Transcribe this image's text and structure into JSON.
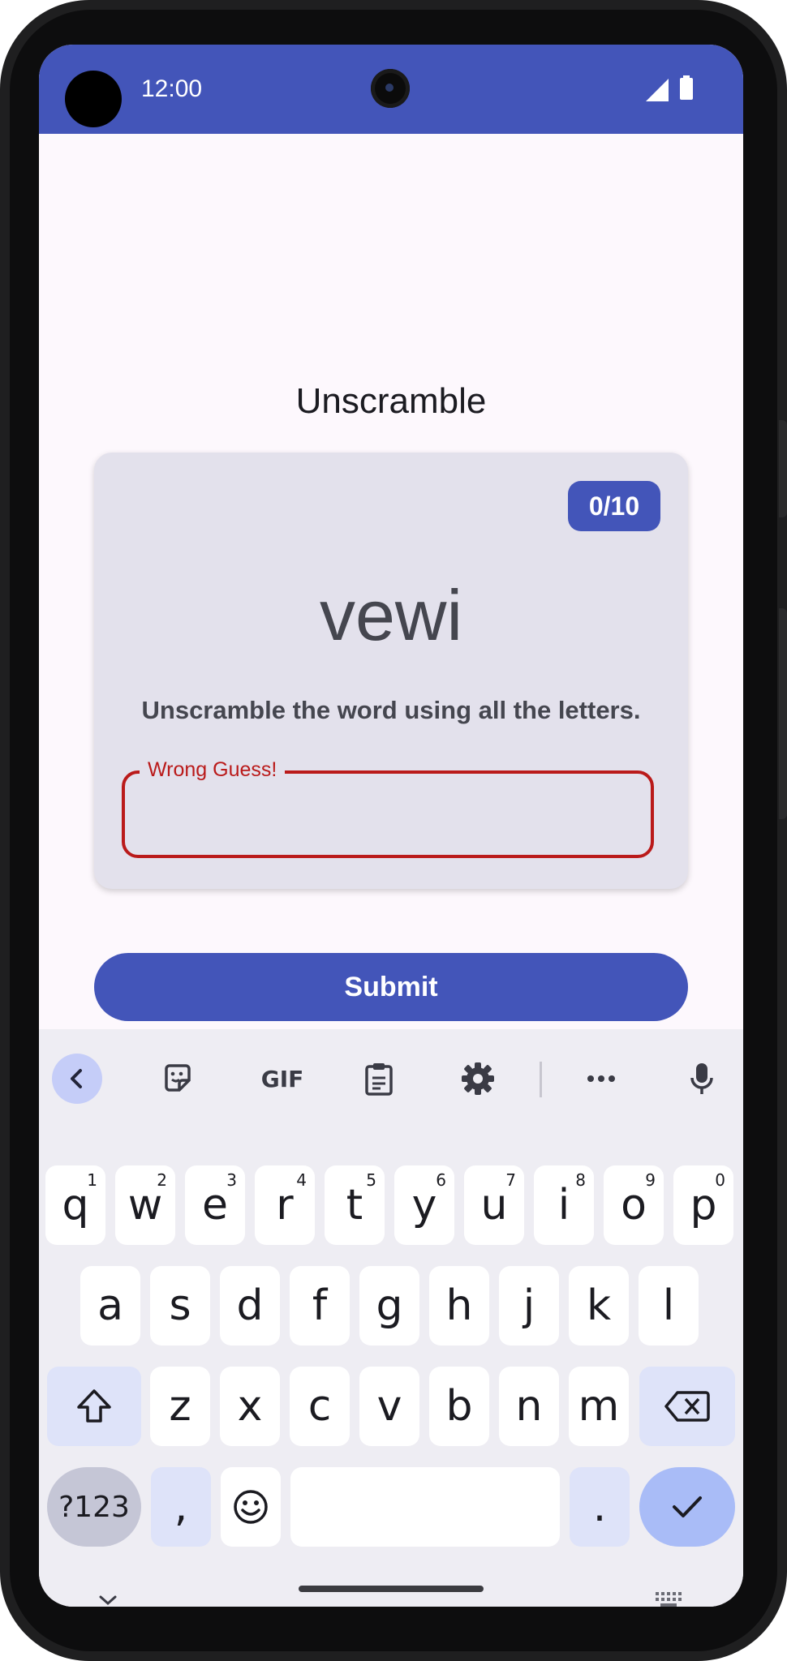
{
  "status_bar": {
    "time": "12:00"
  },
  "app": {
    "title": "Unscramble",
    "score": "0/10",
    "scrambled_word": "vewi",
    "instructions": "Unscramble the word using all the letters.",
    "guess_field": {
      "label": "Wrong Guess!",
      "value": ""
    },
    "submit_label": "Submit"
  },
  "keyboard": {
    "toolbar": [
      "back-icon",
      "sticker-icon",
      "gif-icon",
      "clipboard-icon",
      "gear-icon",
      "more-icon",
      "mic-icon"
    ],
    "gif_label": "GIF",
    "rows": [
      [
        {
          "k": "q",
          "h": "1"
        },
        {
          "k": "w",
          "h": "2"
        },
        {
          "k": "e",
          "h": "3"
        },
        {
          "k": "r",
          "h": "4"
        },
        {
          "k": "t",
          "h": "5"
        },
        {
          "k": "y",
          "h": "6"
        },
        {
          "k": "u",
          "h": "7"
        },
        {
          "k": "i",
          "h": "8"
        },
        {
          "k": "o",
          "h": "9"
        },
        {
          "k": "p",
          "h": "0"
        }
      ],
      [
        {
          "k": "a"
        },
        {
          "k": "s"
        },
        {
          "k": "d"
        },
        {
          "k": "f"
        },
        {
          "k": "g"
        },
        {
          "k": "h"
        },
        {
          "k": "j"
        },
        {
          "k": "k"
        },
        {
          "k": "l"
        }
      ],
      [
        {
          "k": "z"
        },
        {
          "k": "x"
        },
        {
          "k": "c"
        },
        {
          "k": "v"
        },
        {
          "k": "b"
        },
        {
          "k": "n"
        },
        {
          "k": "m"
        }
      ]
    ],
    "symbols_label": "?123",
    "comma": ",",
    "period": "."
  },
  "colors": {
    "primary": "#4355b9",
    "error": "#ba1a1a",
    "card": "#e3e1ec"
  }
}
